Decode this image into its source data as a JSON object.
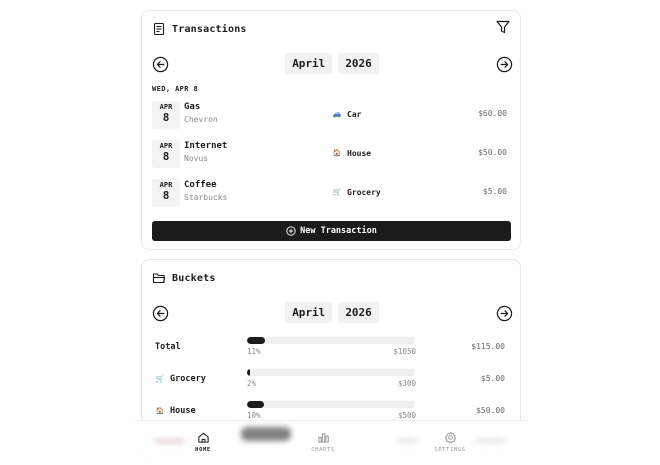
{
  "transactions": {
    "title": "Transactions",
    "month": "April",
    "year": "2026",
    "date_heading": "WED, APR 8",
    "items": [
      {
        "badge_month": "APR",
        "badge_day": "8",
        "name": "Gas",
        "merchant": "Chevron",
        "category": "Car",
        "category_icon": "car-emoji",
        "category_glyph": "🚙",
        "amount": "$60.00"
      },
      {
        "badge_month": "APR",
        "badge_day": "8",
        "name": "Internet",
        "merchant": "Novus",
        "category": "House",
        "category_icon": "house-emoji",
        "category_glyph": "🏠",
        "amount": "$50.00"
      },
      {
        "badge_month": "APR",
        "badge_day": "8",
        "name": "Coffee",
        "merchant": "Starbucks",
        "category": "Grocery",
        "category_icon": "grocery-emoji",
        "category_glyph": "🛒",
        "amount": "$5.00"
      }
    ],
    "new_button_label": "New Transaction"
  },
  "buckets": {
    "title": "Buckets",
    "month": "April",
    "year": "2026",
    "items": [
      {
        "name": "Total",
        "icon": "",
        "glyph": "",
        "progress": 0.11,
        "percent_label": "11%",
        "limit": "$1050",
        "spent": "$115.00"
      },
      {
        "name": "Grocery",
        "icon": "grocery-emoji",
        "glyph": "🛒",
        "progress": 0.02,
        "percent_label": "2%",
        "limit": "$300",
        "spent": "$5.00"
      },
      {
        "name": "House",
        "icon": "house-emoji",
        "glyph": "🏠",
        "progress": 0.1,
        "percent_label": "10%",
        "limit": "$500",
        "spent": "$50.00"
      }
    ]
  },
  "bottom_nav": {
    "items": [
      {
        "label": "HOME",
        "icon": "home-icon",
        "active": true
      },
      {
        "label": "CHARTS",
        "icon": "bar-chart-icon",
        "active": false
      },
      {
        "label": "SETTINGS",
        "icon": "gear-icon",
        "active": false
      }
    ]
  },
  "colors": {
    "primary": "#1b1b1b",
    "muted_text": "#8a8a8a",
    "pill_bg": "#f2f2f2",
    "track_bg": "#efefef",
    "card_border": "#e8e8e8"
  }
}
